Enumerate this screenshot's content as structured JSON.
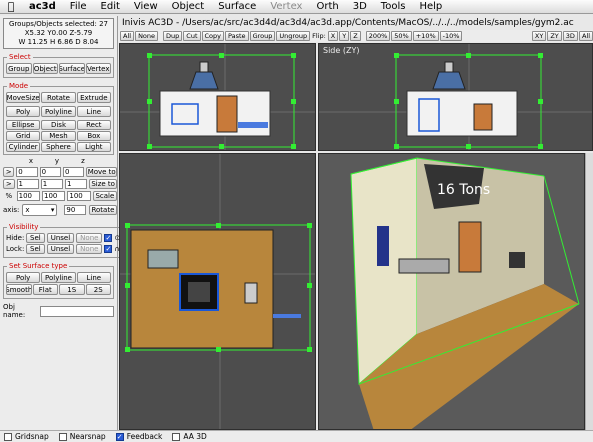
{
  "menubar": {
    "items": [
      "ac3d",
      "File",
      "Edit",
      "View",
      "Object",
      "Surface",
      "Vertex",
      "Orth",
      "3D",
      "Tools",
      "Help"
    ]
  },
  "window": {
    "title": "Inivis AC3D - /Users/ac/src/ac3d4d/ac3d4/ac3d.app/Contents/MacOS/../../../models/samples/gym2.ac"
  },
  "info": {
    "line1": "Groups/Objects selected: 27",
    "line2": "X5.32 Y0.00 Z-5.79",
    "line3": "W 11.25 H 6.86 D 8.04"
  },
  "select": {
    "legend": "Select",
    "buttons": [
      "Group",
      "Object",
      "Surface",
      "Vertex"
    ]
  },
  "mode": {
    "legend": "Mode",
    "row1": [
      "MoveSize",
      "Rotate",
      "Extrude"
    ],
    "row2": [
      "Poly",
      "Polyline",
      "Line"
    ],
    "grid": [
      "Ellipse",
      "Disk",
      "Rect",
      "Grid",
      "Mesh",
      "Box",
      "Cylinder",
      "Sphere",
      "Light"
    ]
  },
  "transform": {
    "headers": [
      "x",
      "y",
      "z"
    ],
    "move": {
      "label": ">",
      "x": "0",
      "y": "0",
      "z": "0",
      "button": "Move to"
    },
    "size": {
      "label": ">",
      "x": "1",
      "y": "1",
      "z": "1",
      "button": "Size to"
    },
    "scale": {
      "label": "%",
      "x": "100",
      "y": "100",
      "z": "100",
      "button": "Scale"
    },
    "axis": {
      "label": "axis:",
      "value": "x",
      "angle": "90",
      "button": "Rotate"
    }
  },
  "visibility": {
    "legend": "Visibility",
    "hide": {
      "label": "Hide:",
      "sel": "Sel",
      "unsel": "Unsel",
      "none": "None"
    },
    "lock": {
      "label": "Lock:",
      "sel": "Sel",
      "unsel": "Unsel",
      "none": "None"
    }
  },
  "surface_type": {
    "legend": "Set Surface type",
    "row1": [
      "Poly",
      "Polyline",
      "Line"
    ],
    "row2": [
      "Smooth",
      "Flat",
      "1S",
      "2S"
    ]
  },
  "objname": {
    "label": "Obj name:",
    "value": ""
  },
  "toolbar": {
    "left": [
      "All",
      "None",
      "Dup",
      "Cut",
      "Copy",
      "Paste",
      "Group",
      "Ungroup"
    ],
    "flip_label": "Flip:",
    "flip": [
      "X",
      "Y",
      "Z"
    ],
    "zoom": [
      "200%",
      "50%",
      "+10%",
      "-10%"
    ],
    "views": [
      "XY",
      "ZY",
      "3D",
      "All"
    ]
  },
  "viewports": {
    "side_label": "Side (ZY)",
    "sign_text": "16 Tons"
  },
  "status": {
    "items": [
      {
        "label": "Gridsnap",
        "checked": false
      },
      {
        "label": "Nearsnap",
        "checked": false
      },
      {
        "label": "Feedback",
        "checked": true
      },
      {
        "label": "AA 3D",
        "checked": false
      }
    ]
  },
  "colors": {
    "selection": "#33ee33",
    "floor": "#b8863c",
    "wall": "#e8e4c8",
    "viewport_bg": "#4d4d4d"
  }
}
